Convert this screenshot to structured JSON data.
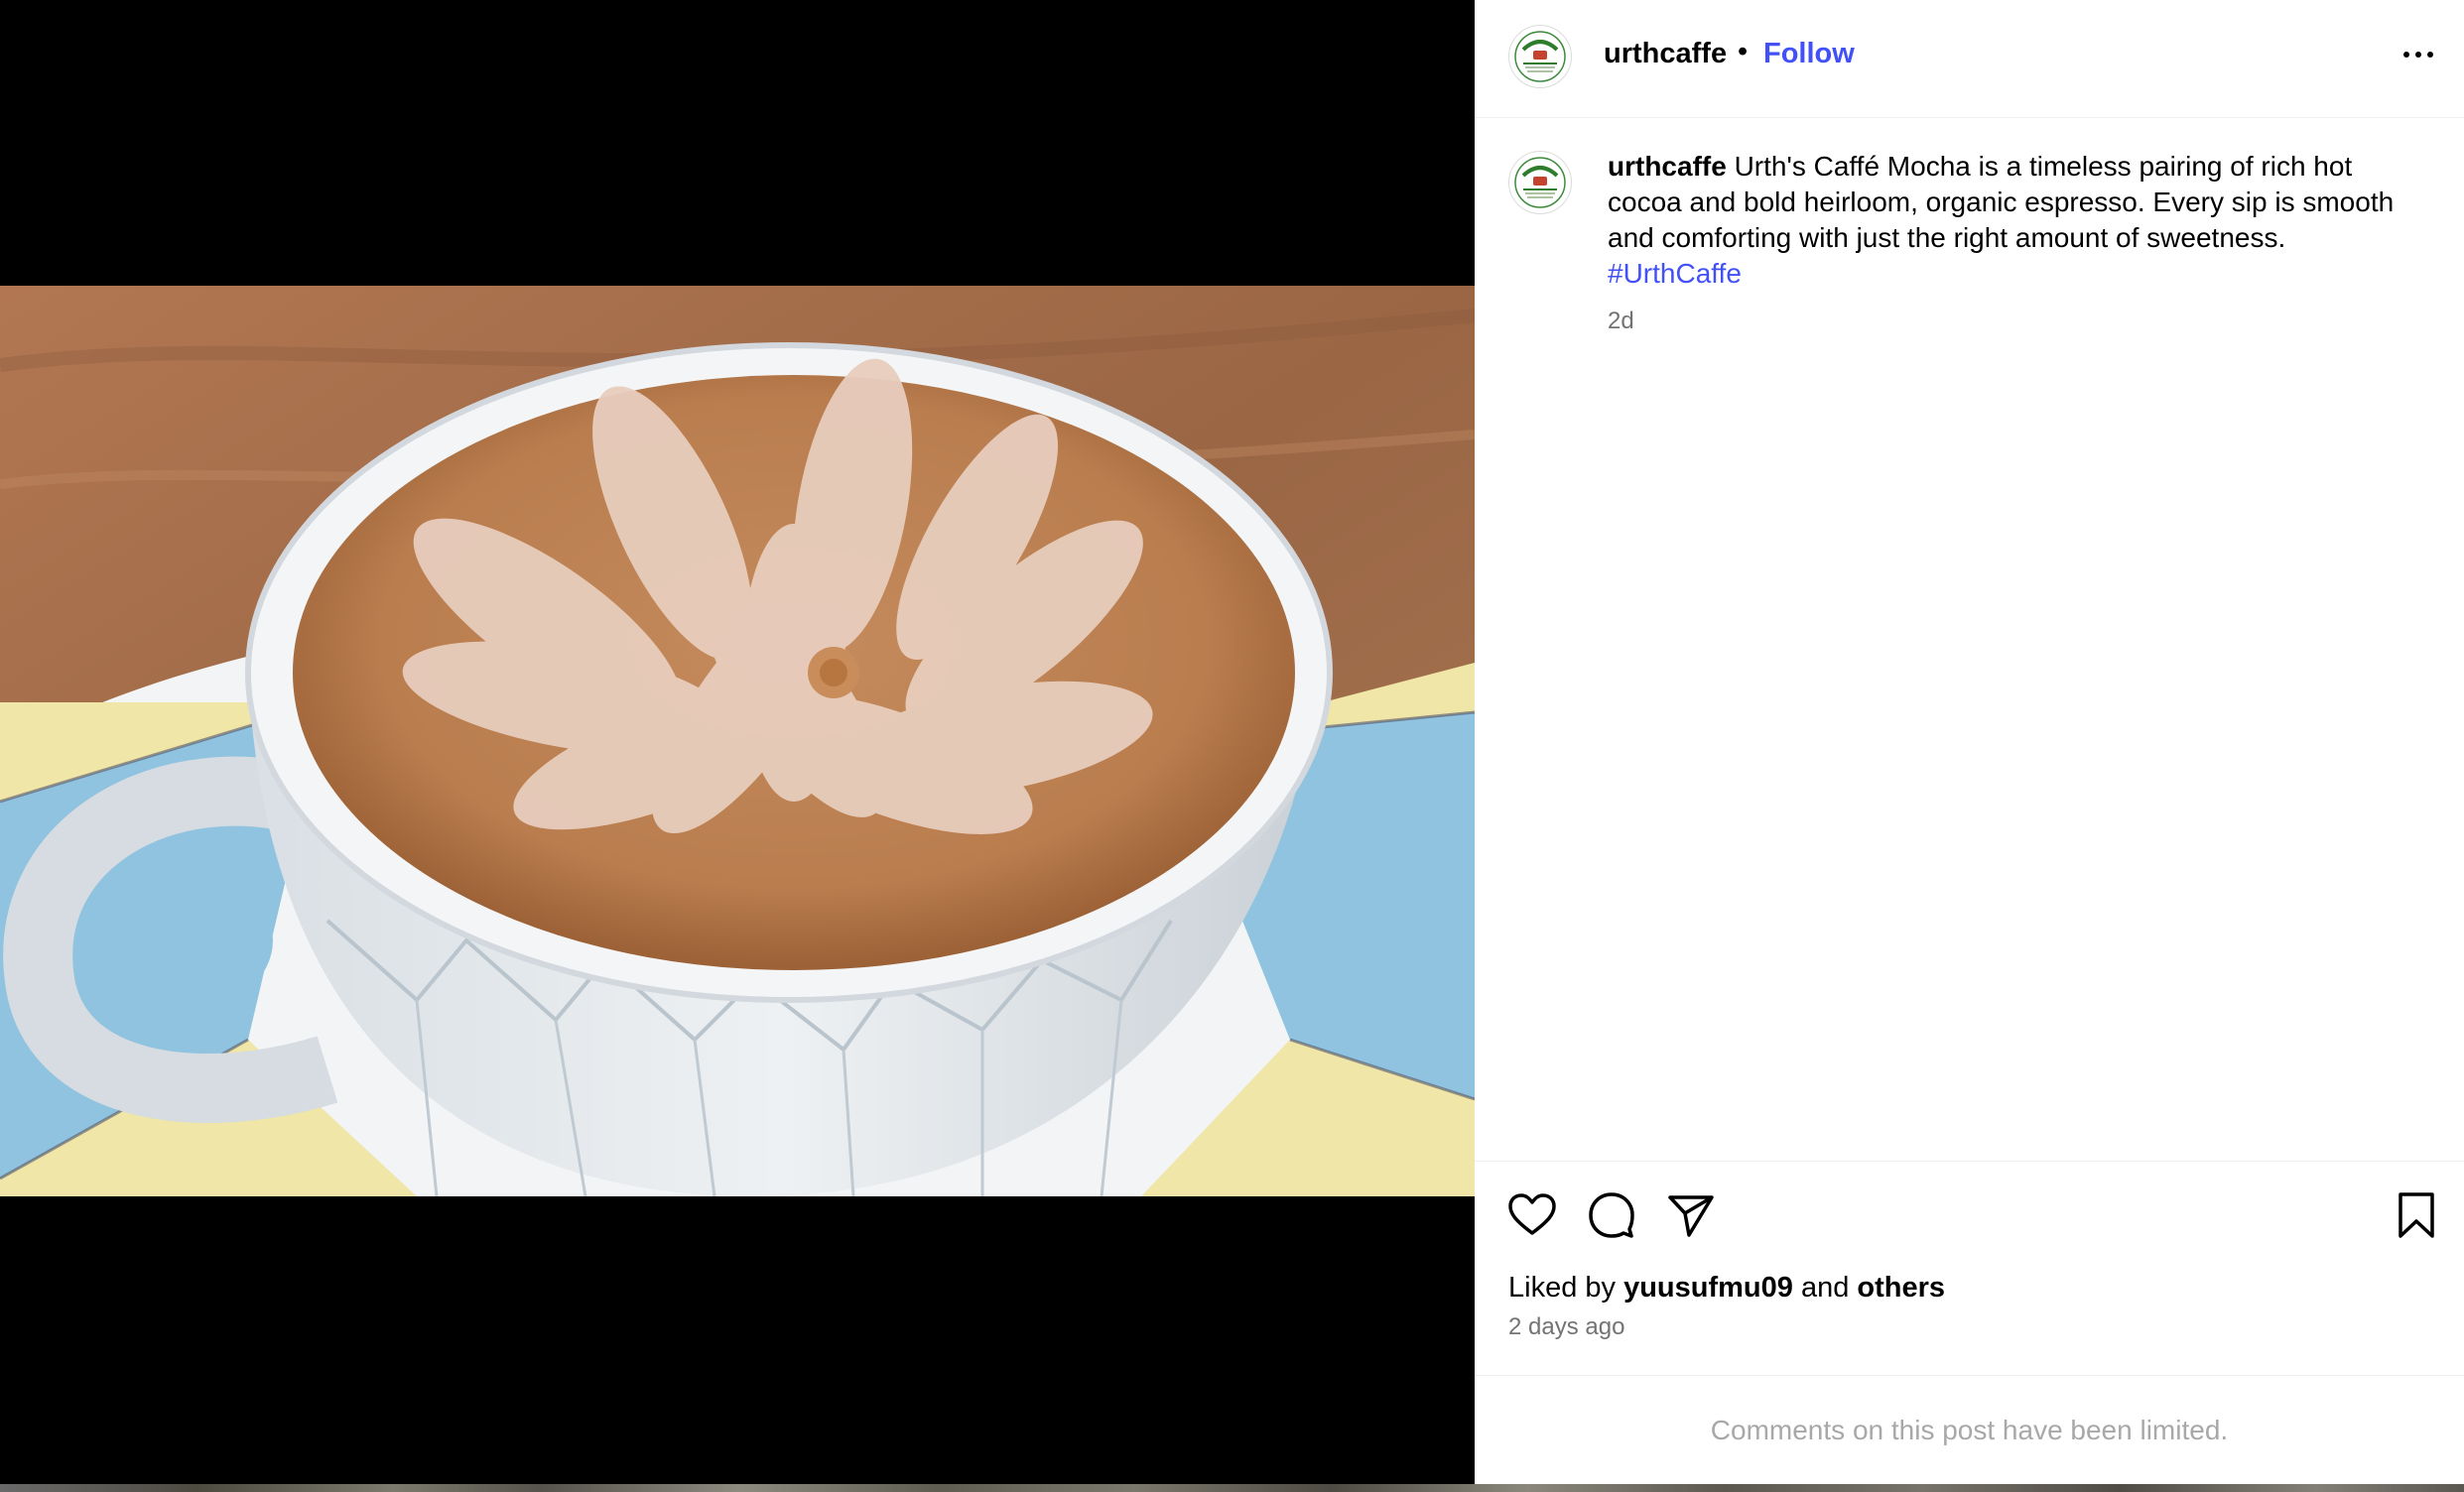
{
  "post": {
    "username": "urthcaffe",
    "separator": "•",
    "follow_label": "Follow",
    "more_icon": "more-horizontal-icon",
    "avatar_logo_text": "Urth Caffé"
  },
  "caption": {
    "username": "urthcaffe",
    "text": "Urth's Caffé Mocha is a timeless pairing of rich hot cocoa and bold heirloom, organic espresso. Every sip is smooth and comforting with just the right amount of sweetness.",
    "hashtag": "#UrthCaffe",
    "time": "2d"
  },
  "media": {
    "subject": "latte-art-coffee-cup"
  },
  "actions": {
    "like_icon": "heart-icon",
    "comment_icon": "comment-icon",
    "share_icon": "paper-plane-icon",
    "save_icon": "bookmark-icon"
  },
  "likes": {
    "prefix": "Liked by",
    "user": "yuusufmu09",
    "conjunction": "and",
    "others": "others",
    "time": "2 days ago"
  },
  "comments": {
    "notice": "Comments on this post have been limited."
  },
  "colors": {
    "link_blue": "#4150f7",
    "muted_text": "#737373",
    "disabled_text": "#a8a8a8"
  }
}
